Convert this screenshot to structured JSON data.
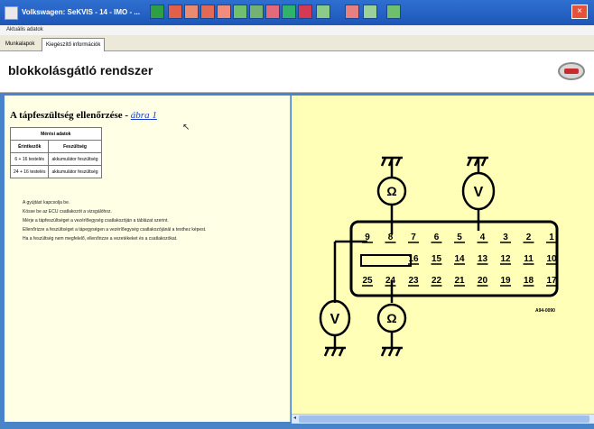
{
  "window": {
    "title": "Volkswagen: SeKVIS - 14 - IMO - ..."
  },
  "breadcrumb": "Aktuális adatok",
  "tabs": [
    {
      "label": "Munkalapok",
      "active": true
    },
    {
      "label": "Kiegészítő információk",
      "active": false
    }
  ],
  "page": {
    "title": "blokkolásgátló rendszer"
  },
  "section": {
    "title": "A tápfeszültség ellenőrzése -",
    "link": "ábra 1"
  },
  "spec_table": {
    "header": "Mérési adatok",
    "columns": [
      "Érintkezők",
      "Feszültség"
    ],
    "rows": [
      [
        "6 + 16 testelés",
        "akkumulátor feszültség"
      ],
      [
        "24 + 16 testelés",
        "akkumulátor feszültség"
      ]
    ]
  },
  "steps": [
    "A gyújtást kapcsolja be.",
    "Kösse be az ECU csatlakozót a vizsgálóhoz.",
    "Mérje a tápfeszültséget a vezérlőegység csatlakozóján a táblázat szerint.",
    "Ellenőrizze a feszültséget a tápegységen a vezérlőegység csatlakozójánál a testhez képest.",
    "Ha a feszültség nem megfelelő, ellenőrizze a vezetékeket és a csatlakozókat."
  ],
  "diagram": {
    "figure_code": "A94-0090",
    "connector_top_row": [
      "9",
      "8",
      "7",
      "6",
      "5",
      "4",
      "3",
      "2",
      "1"
    ],
    "connector_mid_row": [
      "16",
      "15",
      "14",
      "13",
      "12",
      "11",
      "10"
    ],
    "connector_bottom_row": [
      "25",
      "24",
      "23",
      "22",
      "21",
      "20",
      "19",
      "18",
      "17"
    ],
    "meters": {
      "ohm_symbol": "Ω",
      "volt_symbol": "V"
    }
  },
  "colors": {
    "diagram_bg": "#ffffb8",
    "text_bg": "#ffffe6",
    "titlebar": "#1d57b8"
  }
}
